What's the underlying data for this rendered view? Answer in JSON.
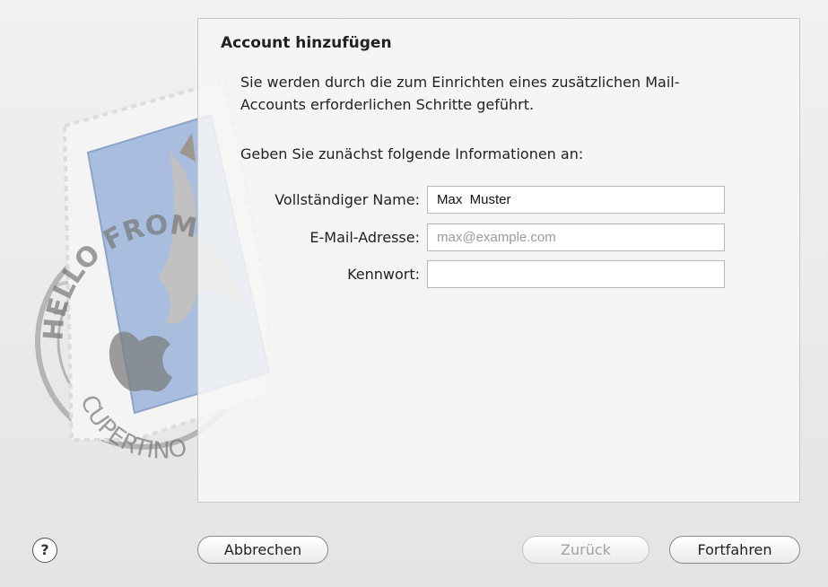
{
  "dialog": {
    "title": "Account hinzufügen",
    "intro": "Sie werden durch die zum Einrichten eines zusätzlichen Mail-Accounts erforderlichen Schritte geführt.",
    "subheading": "Geben Sie zunächst folgende Informationen an:"
  },
  "form": {
    "full_name": {
      "label": "Vollständiger Name:",
      "value": "Max  Muster"
    },
    "email": {
      "label": "E-Mail-Adresse:",
      "placeholder": "max@example.com"
    },
    "password": {
      "label": "Kennwort:",
      "value": ""
    }
  },
  "buttons": {
    "help": "?",
    "cancel": "Abbrechen",
    "back": "Zurück",
    "continue": "Fortfahren"
  },
  "stamp": {
    "text_top": "HELLO FROM",
    "text_bottom": "CUPERTINO",
    "icon": "mail-stamp-icon"
  }
}
